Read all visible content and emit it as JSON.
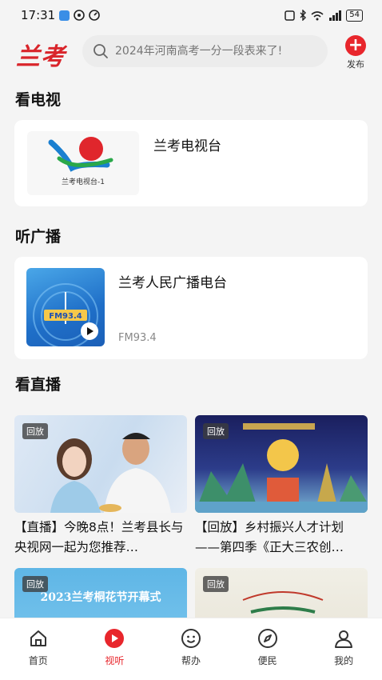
{
  "status_bar": {
    "time": "17:31",
    "battery": "54"
  },
  "header": {
    "logo": "兰考",
    "search_placeholder": "2024年河南高考一分一段表来了!",
    "publish_label": "发布"
  },
  "sections": {
    "tv": "看电视",
    "radio": "听广播",
    "live": "看直播"
  },
  "tv_card": {
    "name": "兰考电视台",
    "logo_caption": "兰考电视台-1"
  },
  "radio_card": {
    "name": "兰考人民广播电台",
    "freq": "FM93.4",
    "art_text": "FM93.4"
  },
  "live_items": [
    {
      "badge": "回放",
      "title": "【直播】今晚8点！兰考县长与央视网一起为您推荐…"
    },
    {
      "badge": "回放",
      "title": "【回放】乡村振兴人才计划——第四季《正大三农创…"
    },
    {
      "badge": "回放",
      "title": "2023兰考桐花节开幕式"
    },
    {
      "badge": "回放",
      "title": ""
    }
  ],
  "tabbar": [
    {
      "label": "首页",
      "icon": "home-icon"
    },
    {
      "label": "视听",
      "icon": "play-circle-icon"
    },
    {
      "label": "帮办",
      "icon": "smile-icon"
    },
    {
      "label": "便民",
      "icon": "compass-icon"
    },
    {
      "label": "我的",
      "icon": "user-icon"
    }
  ],
  "colors": {
    "accent": "#e8262c",
    "background": "#f4f4f4"
  }
}
